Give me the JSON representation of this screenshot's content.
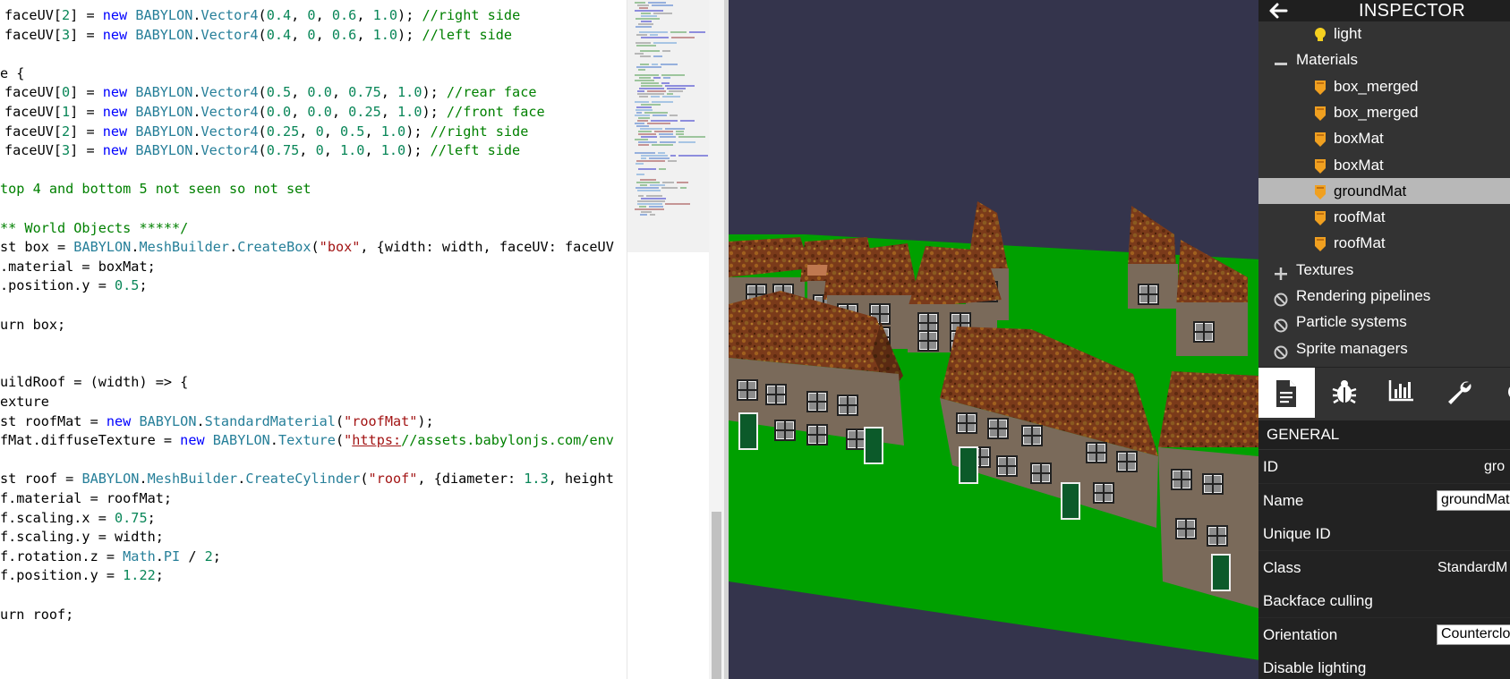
{
  "editor": {
    "lines": [
      "faceUV[2] = new BABYLON.Vector4(0.4, 0, 0.6, 1.0); //right side",
      "faceUV[3] = new BABYLON.Vector4(0.4, 0, 0.6, 1.0); //left side",
      "",
      "e {",
      "faceUV[0] = new BABYLON.Vector4(0.5, 0.0, 0.75, 1.0); //rear face",
      "faceUV[1] = new BABYLON.Vector4(0.0, 0.0, 0.25, 1.0); //front face",
      "faceUV[2] = new BABYLON.Vector4(0.25, 0, 0.5, 1.0); //right side",
      "faceUV[3] = new BABYLON.Vector4(0.75, 0, 1.0, 1.0); //left side",
      "",
      "top 4 and bottom 5 not seen so not set",
      "",
      "** World Objects *****/",
      "st box = BABYLON.MeshBuilder.CreateBox(\"box\", {width: width, faceUV: faceUV",
      ".material = boxMat;",
      ".position.y = 0.5;",
      "",
      "urn box;",
      "",
      "",
      "uildRoof = (width) => {",
      "exture",
      "st roofMat = new BABYLON.StandardMaterial(\"roofMat\");",
      "fMat.diffuseTexture = new BABYLON.Texture(\"https://assets.babylonjs.com/env",
      "",
      "st roof = BABYLON.MeshBuilder.CreateCylinder(\"roof\", {diameter: 1.3, height",
      "f.material = roofMat;",
      "f.scaling.x = 0.75;",
      "f.scaling.y = width;",
      "f.rotation.z = Math.PI / 2;",
      "f.position.y = 1.22;",
      "",
      "urn roof;"
    ]
  },
  "inspector": {
    "title": "INSPECTOR",
    "tree": [
      {
        "label": "light",
        "icon": "lightbulb-icon",
        "indent": 2
      },
      {
        "label": "Materials",
        "icon": "collapse-minus-icon",
        "indent": 1
      },
      {
        "label": "box_merged",
        "icon": "material-icon",
        "indent": 2
      },
      {
        "label": "box_merged",
        "icon": "material-icon",
        "indent": 2
      },
      {
        "label": "boxMat",
        "icon": "material-icon",
        "indent": 2
      },
      {
        "label": "boxMat",
        "icon": "material-icon",
        "indent": 2
      },
      {
        "label": "groundMat",
        "icon": "material-icon",
        "indent": 2,
        "selected": true
      },
      {
        "label": "roofMat",
        "icon": "material-icon",
        "indent": 2
      },
      {
        "label": "roofMat",
        "icon": "material-icon",
        "indent": 2
      },
      {
        "label": "Textures",
        "icon": "expand-plus-icon",
        "indent": 1
      },
      {
        "label": "Rendering pipelines",
        "icon": "disabled-icon",
        "indent": 1
      },
      {
        "label": "Particle systems",
        "icon": "disabled-icon",
        "indent": 1
      },
      {
        "label": "Sprite managers",
        "icon": "disabled-icon",
        "indent": 1
      }
    ],
    "tabs": [
      {
        "name": "properties",
        "icon": "document-icon",
        "active": true
      },
      {
        "name": "debug",
        "icon": "bug-icon"
      },
      {
        "name": "statistics",
        "icon": "chart-icon"
      },
      {
        "name": "tools",
        "icon": "wrench-icon"
      },
      {
        "name": "settings",
        "icon": "gear-icon"
      }
    ],
    "section_title": "GENERAL",
    "properties": [
      {
        "label": "ID",
        "value": "gro"
      },
      {
        "label": "Name",
        "value": "groundMat",
        "input": true
      },
      {
        "label": "Unique ID",
        "value": ""
      },
      {
        "label": "Class",
        "value": "StandardM"
      },
      {
        "label": "Backface culling",
        "value": ""
      },
      {
        "label": "Orientation",
        "value": "Countercloc",
        "input": true
      },
      {
        "label": "Disable lighting",
        "value": ""
      }
    ]
  },
  "colors": {
    "ground": "#00a000",
    "sky": "#34344c",
    "inspector_bg": "#333333",
    "material_icon": "#f0a020",
    "keyword": "#0000ff",
    "comment": "#008000",
    "number": "#098658",
    "string": "#a31515"
  }
}
